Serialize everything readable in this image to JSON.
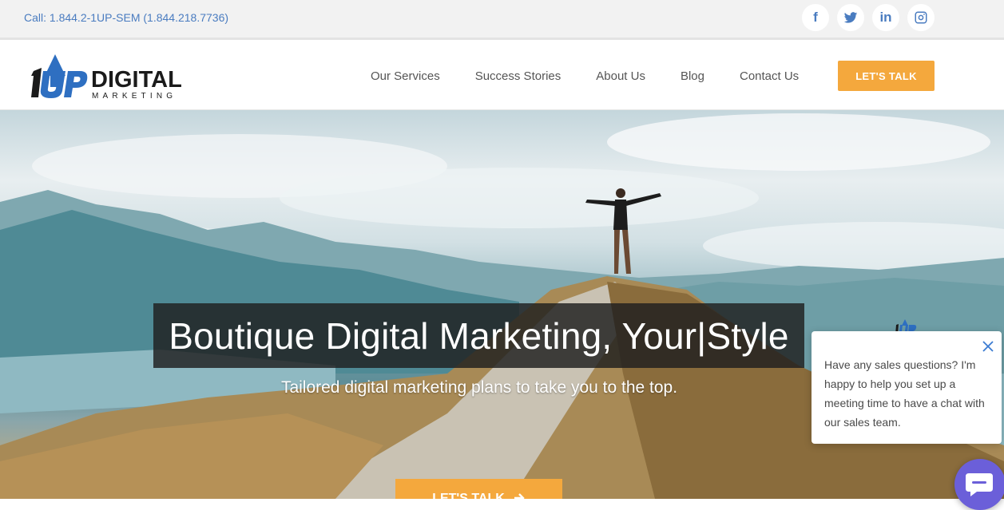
{
  "topbar": {
    "phone": "Call: 1.844.2-1UP-SEM (1.844.218.7736)",
    "social": [
      {
        "icon": "facebook-icon",
        "glyph": "f"
      },
      {
        "icon": "twitter-icon",
        "glyph": ""
      },
      {
        "icon": "linkedin-icon",
        "glyph": "in"
      },
      {
        "icon": "instagram-icon",
        "glyph": ""
      }
    ]
  },
  "header": {
    "logo": {
      "mark": "1UP",
      "word": "DIGITAL",
      "tagline": "MARKETING"
    },
    "nav": [
      "Our Services",
      "Success Stories",
      "About Us",
      "Blog",
      "Contact Us"
    ],
    "cta_label": "LET'S TALK"
  },
  "hero": {
    "headline": "Boutique Digital Marketing, Your|Style",
    "subline": "Tailored digital marketing plans to take you to the top.",
    "cta_label": "LET'S TALK",
    "cta_icon": "arrow-right-icon"
  },
  "chat": {
    "message": "Have any sales questions? I'm happy to help you set up a meeting time to have a chat with our sales team.",
    "close_icon": "close-icon",
    "launcher_icon": "chat-icon"
  },
  "colors": {
    "accent": "#f4a83d",
    "link": "#4a7cc0",
    "logo_blue": "#2e6fc1",
    "chat_launcher": "#6b5fd9"
  }
}
